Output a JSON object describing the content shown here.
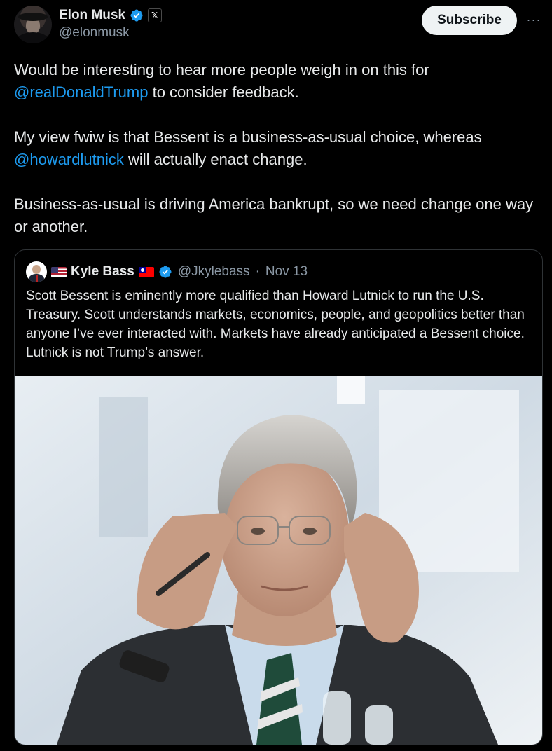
{
  "author": {
    "display_name": "Elon Musk",
    "handle": "@elonmusk",
    "verified_icon": "verified-badge-icon",
    "affiliate_icon": "x-logo-icon",
    "affiliate_glyph": "𝕏"
  },
  "actions": {
    "subscribe_label": "Subscribe",
    "more_glyph": "···"
  },
  "tweet": {
    "p1_a": "Would be interesting to hear more people weigh in on this for ",
    "p1_mention": "@realDonaldTrump",
    "p1_b": " to consider feedback.",
    "p2_a": "My view fwiw is that Bessent is a business-as-usual choice, whereas ",
    "p2_mention": "@howardlutnick",
    "p2_b": " will actually enact change.",
    "p3": "Business-as-usual is driving America bankrupt, so we need change one way or another."
  },
  "quote": {
    "display_name": "Kyle Bass",
    "handle": "@Jkylebass",
    "separator": "·",
    "date": "Nov 13",
    "text": "Scott Bessent is eminently more qualified than Howard Lutnick to run the U.S. Treasury. Scott understands markets, economics, people, and geopolitics better than anyone I’ve ever interacted with. Markets have already anticipated a Bessent choice. Lutnick is not Trump’s answer."
  },
  "colors": {
    "background": "#000000",
    "text": "#e7e9ea",
    "secondary_text": "#8b98a5",
    "link": "#1d9bf0",
    "verified": "#1d9bf0",
    "border": "#2f3336"
  }
}
